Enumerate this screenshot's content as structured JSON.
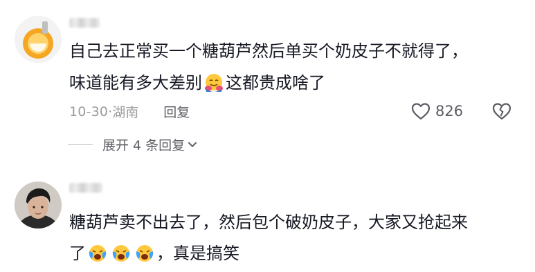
{
  "comments": [
    {
      "line1": "自己去正常买一个糖葫芦然后单买个奶皮子不就得了，",
      "line2_before": "味道能有多大差别",
      "line2_after": "这都贵成啥了",
      "date": "10-30",
      "location": "湖南",
      "reply_label": "回复",
      "like_count": "826",
      "expand_label": "展开 4 条回复",
      "emoji_icons": [
        "hugging-face-icon"
      ]
    },
    {
      "line1": "糖葫芦卖不出去了，然后包个破奶皮子，大家又抢起来",
      "line2_before": "了",
      "line2_after": "，真是搞笑",
      "emoji_icons": [
        "crying-face-icon",
        "crying-face-icon",
        "crying-face-icon"
      ]
    }
  ],
  "colors": {
    "text": "#161823",
    "secondary": "#9c9c9c",
    "action": "#5f5f66",
    "avatar_orange": "#f5a623"
  }
}
